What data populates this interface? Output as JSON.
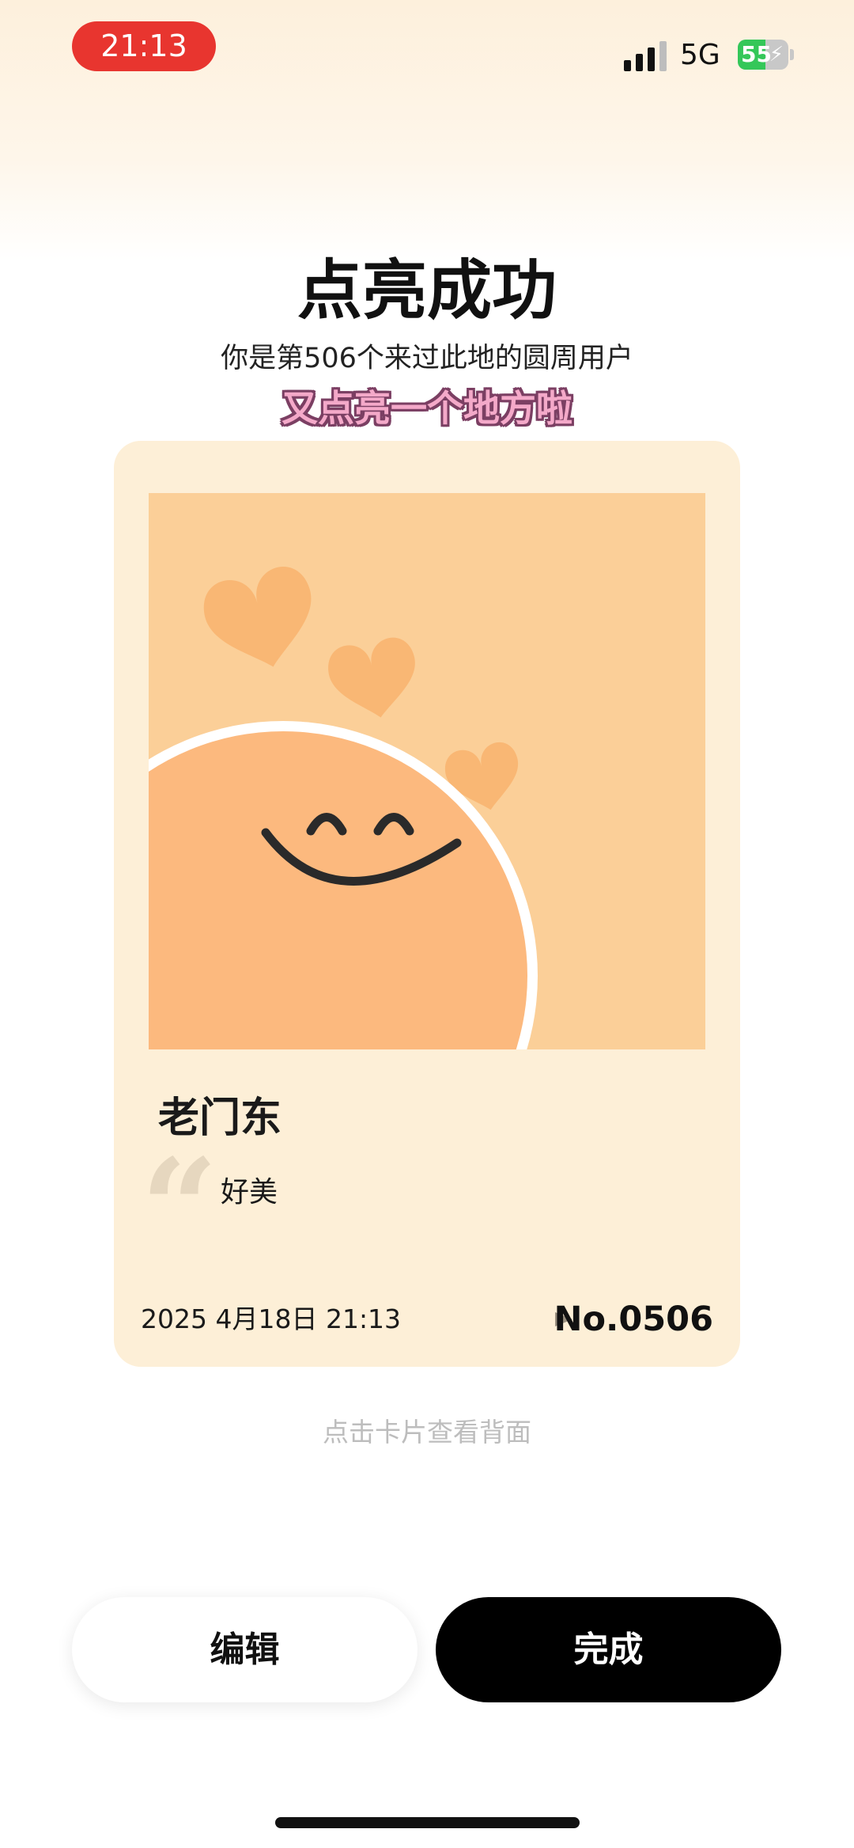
{
  "status_bar": {
    "time": "21:13",
    "network": "5G",
    "battery": "55",
    "battery_level_percent": 55,
    "icons": [
      "signal-icon",
      "battery-icon",
      "charging-bolt-icon"
    ]
  },
  "header": {
    "title": "点亮成功",
    "subtitle": "你是第506个来过此地的圆周用户",
    "sticker": "又点亮一个地方啦"
  },
  "card": {
    "place_name": "老门东",
    "quote_mark": "“",
    "comment": "好美",
    "date": "2025  4月18日 21:13",
    "number": "No.0506",
    "illustration": "smiling-face-with-hearts",
    "colors": {
      "card_bg": "#fdefd7",
      "image_bg": "#fbcf98",
      "face": "#fcb97e",
      "hearts": "#f9b774"
    }
  },
  "hint": "点击卡片查看背面",
  "buttons": {
    "edit": "编辑",
    "done": "完成"
  },
  "colors": {
    "time_pill": "#e8352f",
    "done_button": "#000000",
    "sticker_fill": "#f4a9c9"
  }
}
